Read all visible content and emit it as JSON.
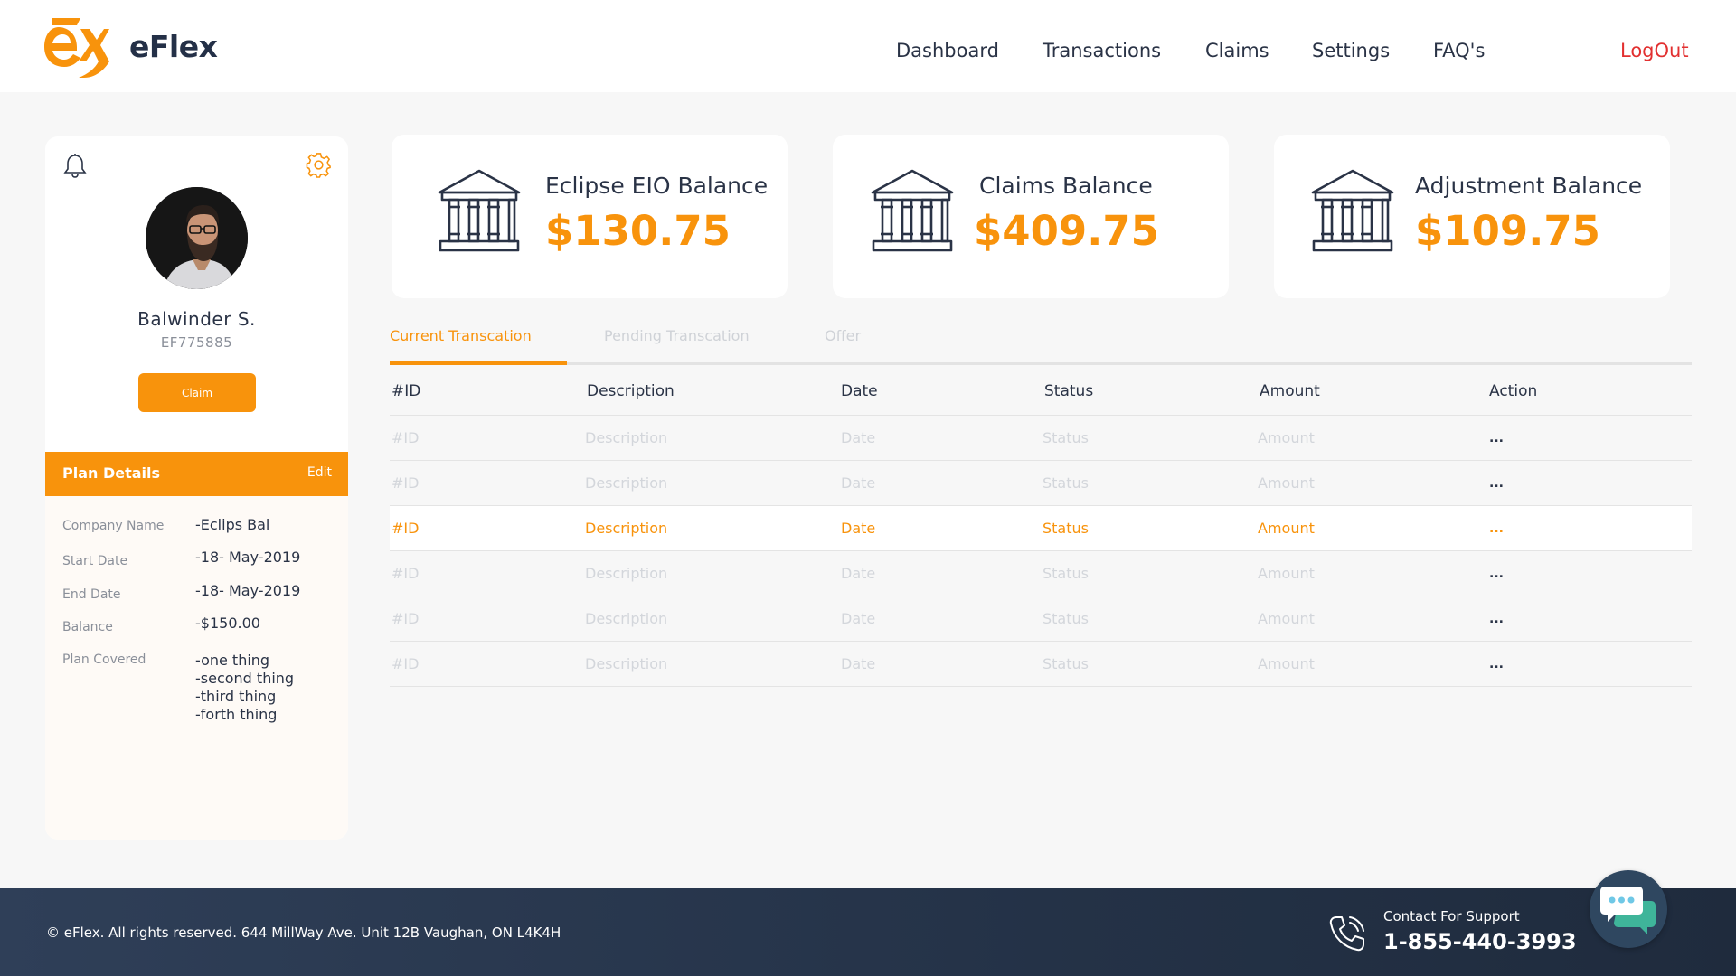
{
  "brand": {
    "name": "eFlex"
  },
  "nav": {
    "items": [
      {
        "label": "Dashboard"
      },
      {
        "label": "Transactions"
      },
      {
        "label": "Claims"
      },
      {
        "label": "Settings"
      },
      {
        "label": "FAQ's"
      }
    ],
    "logout_label": "LogOut"
  },
  "profile": {
    "name": "Balwinder S.",
    "id": "EF775885",
    "claim_label": "Claim",
    "icons": {
      "notifications": "bell-icon",
      "settings": "gear-icon"
    }
  },
  "plan": {
    "title": "Plan Details",
    "edit_label": "Edit",
    "fields": [
      {
        "label": "Company Name",
        "value": "-Eclips Bal"
      },
      {
        "label": "Start Date",
        "value": "-18- May-2019"
      },
      {
        "label": "End Date",
        "value": "-18- May-2019"
      },
      {
        "label": "Balance",
        "value": "-$150.00"
      },
      {
        "label": "Plan Covered",
        "value": "-one thing\n-second thing\n-third thing\n-forth thing"
      }
    ],
    "covered_items": [
      "-one thing",
      "-second thing",
      "-third thing",
      "-forth thing"
    ]
  },
  "balances": [
    {
      "title": "Eclipse EIO Balance",
      "amount": "$130.75",
      "icon": "bank-icon"
    },
    {
      "title": "Claims Balance",
      "amount": "$409.75",
      "icon": "bank-icon"
    },
    {
      "title": "Adjustment Balance",
      "amount": "$109.75",
      "icon": "bank-icon"
    }
  ],
  "tabs": [
    {
      "label": "Current Transcation",
      "active": true
    },
    {
      "label": "Pending Transcation",
      "active": false
    },
    {
      "label": "Offer",
      "active": false
    }
  ],
  "table": {
    "columns": [
      "#ID",
      "Description",
      "Date",
      "Status",
      "Amount",
      "Action"
    ],
    "rows": [
      {
        "id": "#ID",
        "description": "Description",
        "date": "Date",
        "status": "Status",
        "amount": "Amount",
        "action": "..."
      },
      {
        "id": "#ID",
        "description": "Description",
        "date": "Date",
        "status": "Status",
        "amount": "Amount",
        "action": "..."
      },
      {
        "id": "#ID",
        "description": "Description",
        "date": "Date",
        "status": "Status",
        "amount": "Amount",
        "action": "..."
      },
      {
        "id": "#ID",
        "description": "Description",
        "date": "Date",
        "status": "Status",
        "amount": "Amount",
        "action": "..."
      },
      {
        "id": "#ID",
        "description": "Description",
        "date": "Date",
        "status": "Status",
        "amount": "Amount",
        "action": "..."
      },
      {
        "id": "#ID",
        "description": "Description",
        "date": "Date",
        "status": "Status",
        "amount": "Amount",
        "action": "..."
      }
    ],
    "highlighted_row": 2
  },
  "footer": {
    "copyright": "© eFlex. All rights reserved. 644 MillWay Ave. Unit 12B Vaughan, ON L4K4H",
    "support_label": "Contact For Support",
    "support_phone": "1-855-440-3993",
    "icons": {
      "phone": "phone-icon",
      "chat": "chat-icon"
    }
  },
  "colors": {
    "accent": "#f8930c",
    "text": "#2a3346",
    "muted": "#8a8f99",
    "logout": "#e23030",
    "footer": "#243247"
  }
}
